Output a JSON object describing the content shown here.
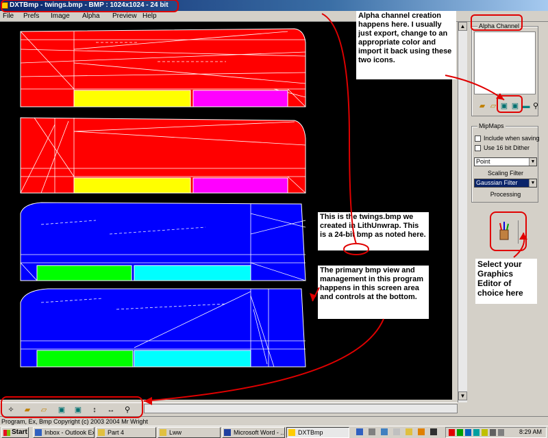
{
  "window": {
    "title": "DXTBmp - twings.bmp - BMP : 1024x1024 - 24 bit"
  },
  "menu": {
    "items": [
      "File",
      "Prefs",
      "Image",
      "Alpha",
      "Preview",
      "Help"
    ]
  },
  "right_panel": {
    "alpha_group_title": "Alpha Channel",
    "alpha_icons": [
      "folder-open-icon",
      "folder-arrow-icon",
      "export-image-icon",
      "import-image-icon",
      "image-icon",
      "magnifier-icon"
    ],
    "mipmaps_group_title": "MipMaps",
    "checkboxes": [
      {
        "label": "Include when saving",
        "checked": false
      },
      {
        "label": "Use 16 bit Dither",
        "checked": false
      }
    ],
    "filter_select": "Point",
    "scaling_label": "Scaling Filter",
    "scaling_select": "Gaussian Filter",
    "processing_label": "Processing",
    "graphics_editor_icon": "paint-brushes-icon"
  },
  "bottom_toolbar": {
    "icons": [
      "wand-icon",
      "open-file-icon",
      "folder-icon",
      "image-export-icon",
      "image-import-icon",
      "flip-vertical-icon",
      "flip-horizontal-icon",
      "zoom-icon"
    ]
  },
  "status": {
    "text": "Program, Ex, Bmp Copyright (c) 2003 2004 Mr Wright"
  },
  "taskbar": {
    "start": "Start",
    "tasks": [
      {
        "label": "Inbox - Outlook Ex..."
      },
      {
        "label": "Part 4"
      },
      {
        "label": "Lww"
      },
      {
        "label": "Microsoft Word - ..."
      },
      {
        "label": "DXTBmp"
      }
    ],
    "clock": "8:29 AM"
  },
  "annotations": {
    "alpha_note": "Alpha channel creation happens here.  I usually just export, change to an appropriate color and import it back using these two icons.",
    "bmp_note_1": "This is the twings.bmp we created in LithUnwrap. This is a 24-bit bmp as noted here.",
    "bmp_note_2": "The primary bmp view and management in this program happens in this screen area and controls at the bottom.",
    "editor_note": "Select your Graphics Editor of choice here"
  },
  "colors": {
    "annotation": "#e00000",
    "title_bar": "#0a246a",
    "uv_red": "#ff0000",
    "uv_blue": "#0000ff",
    "uv_yellow": "#ffff00",
    "uv_magenta": "#ff00ff",
    "uv_green": "#00ff00",
    "uv_cyan": "#00ffff"
  }
}
